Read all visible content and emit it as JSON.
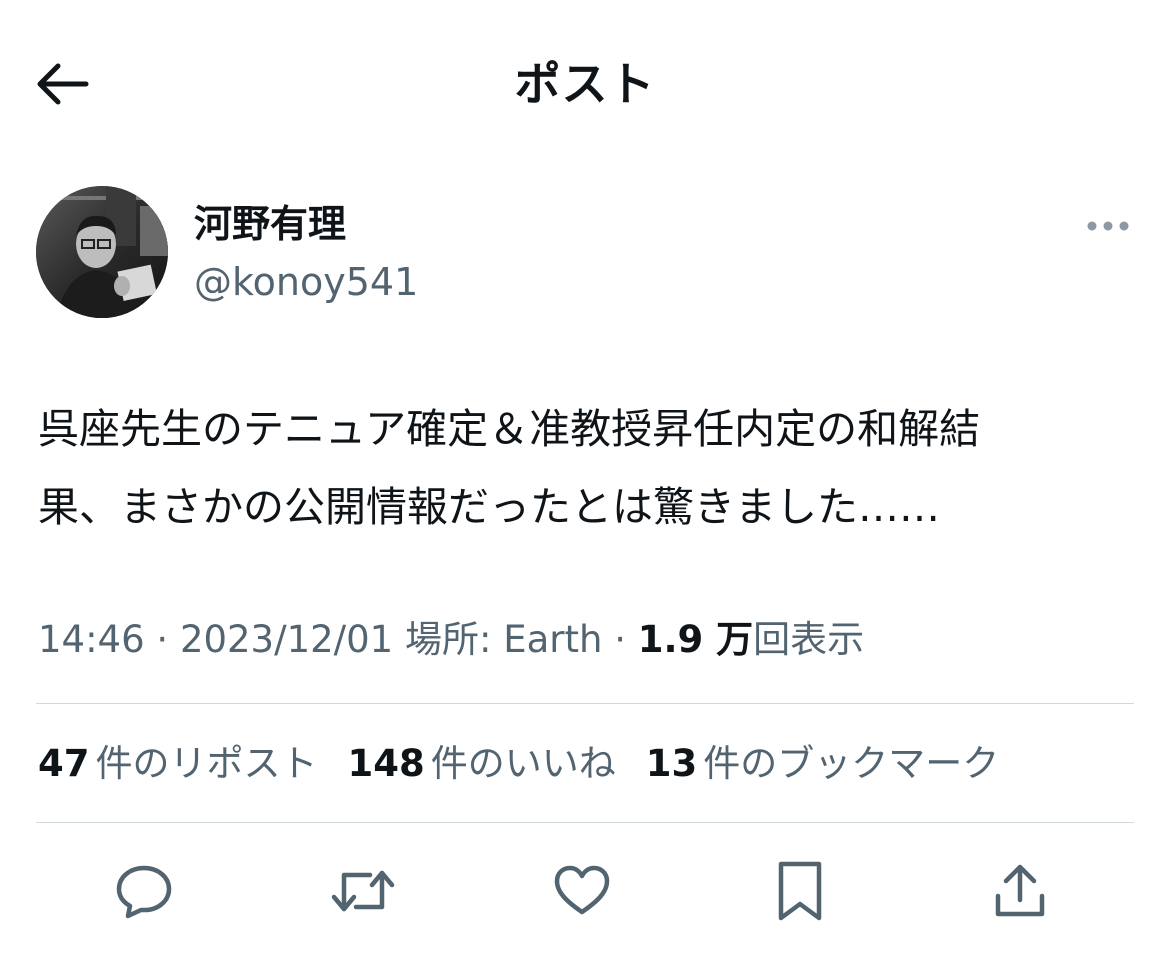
{
  "header": {
    "title": "ポスト",
    "back_icon": "arrow-left-icon"
  },
  "author": {
    "name": "河野有理",
    "handle": "@konoy541",
    "more_icon": "more-horizontal-icon"
  },
  "post": {
    "text_line1": "呉座先生のテニュア確定＆准教授昇任内定の和解結",
    "text_line2": "果、まさかの公開情報だったとは驚きました……"
  },
  "meta": {
    "time": "14:46",
    "sep1": " · ",
    "date": "2023/12/01",
    "location_label": "場所: ",
    "location": "Earth",
    "sep2": " · ",
    "views_count": "1.9 万",
    "views_label": "回表示"
  },
  "stats": {
    "reposts_count": "47",
    "reposts_label": "件のリポスト",
    "likes_count": "148",
    "likes_label": "件のいいね",
    "bookmarks_count": "13",
    "bookmarks_label": "件のブックマーク"
  },
  "actions": {
    "reply_icon": "reply-icon",
    "repost_icon": "repost-icon",
    "like_icon": "heart-icon",
    "bookmark_icon": "bookmark-icon",
    "share_icon": "share-icon"
  },
  "colors": {
    "text": "#0f1419",
    "secondary": "#536471",
    "divider": "#cfd9de",
    "background": "#ffffff"
  }
}
